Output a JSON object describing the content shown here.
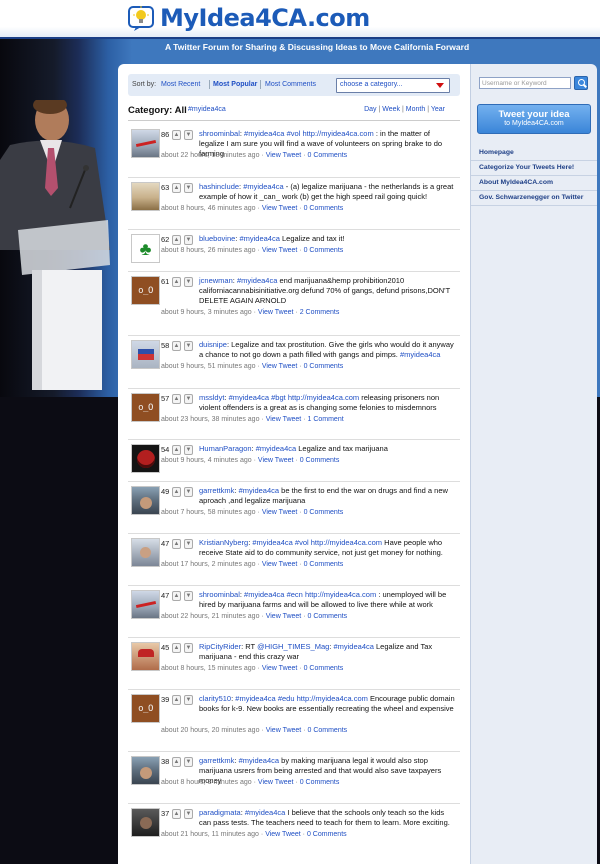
{
  "site": {
    "logo": "MyIdea4CA.com",
    "tagline": "A Twitter Forum for Sharing & Discussing Ideas to Move California Forward"
  },
  "sortbar": {
    "label": "Sort by:",
    "options": [
      "Most Recent",
      "Most Popular",
      "Most Comments"
    ],
    "active": "Most Popular",
    "category_select": "choose a category..."
  },
  "category": {
    "heading": "Category: All",
    "tag": "#myidea4ca",
    "periods": [
      "Day",
      "Week",
      "Month",
      "Year"
    ]
  },
  "tweets": [
    {
      "score": "86",
      "user": "shroominbal",
      "text": ": #myidea4ca #vol http://myidea4ca.com : in the matter of legalize I am sure you will find a wave of volunteers on spring brake to do farming",
      "time": "about 22 hours, 18 minutes ago",
      "view": "View Tweet",
      "comments": "0 Comments",
      "avatar": "plane-avatar"
    },
    {
      "score": "63",
      "user": "hashinclude",
      "text": ": #myidea4ca - (a) legalize marijuana - the netherlands is a great example of how it _can_ work (b) get the high speed rail going quick!",
      "time": "about 8 hours, 46 minutes ago",
      "view": "View Tweet",
      "comments": "0 Comments",
      "avatar": "beach-avatar"
    },
    {
      "score": "62",
      "user": "bluebovine",
      "text": ": #myidea4ca Legalize and tax it!",
      "time": "about 8 hours, 26 minutes ago",
      "view": "View Tweet",
      "comments": "0 Comments",
      "avatar": "clover-avatar"
    },
    {
      "score": "61",
      "user": "jcnewman",
      "text": ": #myidea4ca end marijuana&hemp prohibition2010 californiacannabisinitiative.org defund 70% of gangs, defund prisons,DON'T DELETE AGAIN ARNOLD",
      "time": "about 9 hours, 3 minutes ago",
      "view": "View Tweet",
      "comments": "2 Comments",
      "avatar": "default-avatar"
    },
    {
      "score": "58",
      "user": "duisnipe",
      "text": ": Legalize and tax prostitution. Give the girls who would do it anyway a chance to not go down a path filled with gangs and pimps. #myidea4ca",
      "time": "about 9 hours, 51 minutes ago",
      "view": "View Tweet",
      "comments": "0 Comments",
      "avatar": "flag-avatar"
    },
    {
      "score": "57",
      "user": "mssldyt",
      "text": ": #myidea4ca #bgt http://myidea4ca.com releasing prisoners non violent offenders is a great as is changing some felonies to misdemnors",
      "time": "about 23 hours, 38 minutes ago",
      "view": "View Tweet",
      "comments": "1 Comment",
      "avatar": "default-avatar"
    },
    {
      "score": "54",
      "user": "HumanParagon",
      "text": ": #myidea4ca Legalize and tax marijuana",
      "time": "about 9 hours, 4 minutes ago",
      "view": "View Tweet",
      "comments": "0 Comments",
      "avatar": "smiley-avatar"
    },
    {
      "score": "49",
      "user": "garrettkmk",
      "text": ": #myidea4ca be the first to end the war on drugs and find a new aproach ,and legalize marijuana",
      "time": "about 7 hours, 58 minutes ago",
      "view": "View Tweet",
      "comments": "0 Comments",
      "avatar": "photo-avatar"
    },
    {
      "score": "47",
      "user": "KristianNyberg",
      "text": ": #myidea4ca #vol http://myidea4ca.com Have people who receive State aid to do community service, not just get money for nothing.",
      "time": "about 17 hours, 2 minutes ago",
      "view": "View Tweet",
      "comments": "0 Comments",
      "avatar": "photo2-avatar"
    },
    {
      "score": "47",
      "user": "shroominbal",
      "text": ": #myidea4ca #ecn http://myidea4ca.com : unemployed will be hired by marijuana farms and will be allowed to live there while at work",
      "time": "about 22 hours, 21 minutes ago",
      "view": "View Tweet",
      "comments": "0 Comments",
      "avatar": "plane-avatar"
    },
    {
      "score": "45",
      "user": "RipCityRider",
      "text": ": RT @HIGH_TIMES_Mag: #myidea4ca Legalize and Tax marijuana - end this crazy war",
      "time": "about 8 hours, 15 minutes ago",
      "view": "View Tweet",
      "comments": "0 Comments",
      "avatar": "rider-avatar"
    },
    {
      "score": "39",
      "user": "clarity510",
      "text": ": #myidea4ca #edu http://myidea4ca.com Encourage public domain books for k-9. New books are essentially recreating the wheel and expensive",
      "time": "about 20 hours, 20 minutes ago",
      "view": "View Tweet",
      "comments": "0 Comments",
      "avatar": "default-avatar"
    },
    {
      "score": "38",
      "user": "garrettkmk",
      "text": ": #myidea4ca by making marijuana legal it would also stop marijuana usrers from being arrested and that would also save taxpayers money",
      "time": "about 8 hours, 3 minutes ago",
      "view": "View Tweet",
      "comments": "0 Comments",
      "avatar": "photo-avatar"
    },
    {
      "score": "37",
      "user": "paradigmata",
      "text": ": #myidea4ca I believe that the schools only teach so the kids can pass tests. The teachers need to teach for them to learn. More exciting.",
      "time": "about 21 hours, 11 minutes ago",
      "view": "View Tweet",
      "comments": "0 Comments",
      "avatar": "dark-avatar"
    }
  ],
  "sidebar": {
    "search_placeholder": "Username or Keyword",
    "tweet_button": {
      "line1": "Tweet your idea",
      "line2": "to MyIdea4CA.com"
    },
    "links": [
      "Homepage",
      "Categorize Your Tweets Here!",
      "About MyIdea4CA.com",
      "Gov. Schwarzenegger on Twitter"
    ]
  }
}
